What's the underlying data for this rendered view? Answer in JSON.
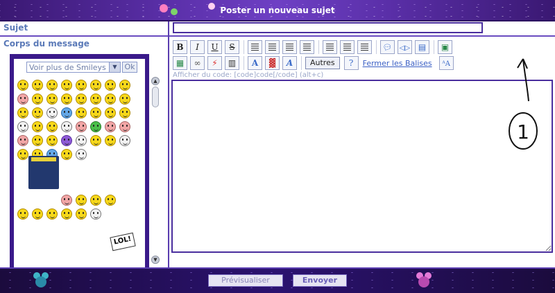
{
  "header": {
    "title": "Poster un nouveau sujet"
  },
  "left": {
    "subject_label": "Sujet",
    "body_label": "Corps du message",
    "smiley_select": "Voir plus de Smileys",
    "ok_button": "Ok",
    "sign_text": "LOL!"
  },
  "editor": {
    "subject_value": "",
    "buttons": {
      "bold": "B",
      "italic": "I",
      "underline": "U",
      "strike": "S",
      "autres": "Autres",
      "fermer": "Fermer les Balises"
    },
    "hint": "Afficher du code: [code]code[/code] (alt+c)",
    "message_value": ""
  },
  "annotation": {
    "number": "1"
  },
  "footer": {
    "preview_button": "Prévisualiser",
    "send_button": "Envoyer"
  }
}
